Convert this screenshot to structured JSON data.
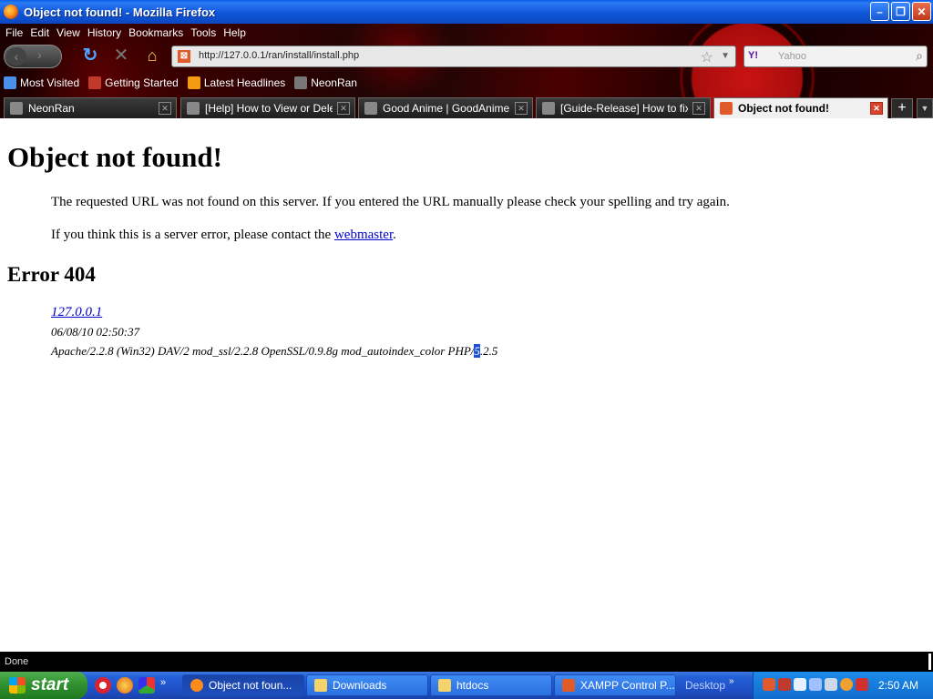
{
  "window": {
    "title": "Object not found! - Mozilla Firefox",
    "minimize_glyph": "–",
    "maximize_glyph": "❐",
    "close_glyph": "✕"
  },
  "menu": [
    "File",
    "Edit",
    "View",
    "History",
    "Bookmarks",
    "Tools",
    "Help"
  ],
  "nav": {
    "back_icon": "back-arrow-icon",
    "forward_icon": "forward-arrow-icon",
    "reload_icon": "reload-icon",
    "stop_icon": "stop-icon",
    "home_icon": "home-icon"
  },
  "urlbar": {
    "url": "http://127.0.0.1/ran/install/install.php",
    "site_icon": "xampp-icon"
  },
  "searchbar": {
    "engine": "Y!",
    "placeholder": "Yahoo"
  },
  "bookmarks": [
    {
      "label": "Most Visited",
      "icon": "most-visited-icon",
      "color": "#4a8fe8"
    },
    {
      "label": "Getting Started",
      "icon": "firefox-icon",
      "color": "#c0392b"
    },
    {
      "label": "Latest Headlines",
      "icon": "rss-icon",
      "color": "#f39c12"
    },
    {
      "label": "NeonRan",
      "icon": "neonran-icon",
      "color": "#777777"
    }
  ],
  "tabs": [
    {
      "label": "NeonRan",
      "active": false
    },
    {
      "label": "[Help] How to View or Delet...",
      "active": false
    },
    {
      "label": "Good Anime | GoodAnime.Net",
      "active": false
    },
    {
      "label": "[Guide-Release] How to fix ...",
      "active": false
    },
    {
      "label": "Object not found!",
      "active": true
    }
  ],
  "page": {
    "heading": "Object not found!",
    "p1": "The requested URL was not found on this server. If you entered the URL manually please check your spelling and try again.",
    "p2_prefix": "If you think this is a server error, please contact the ",
    "p2_link": "webmaster",
    "p2_suffix": ".",
    "error_heading": "Error 404",
    "address": "127.0.0.1",
    "datetime": "06/08/10 02:50:37",
    "server_pre": "Apache/2.2.8 (Win32) DAV/2 mod_ssl/2.2.8 OpenSSL/0.9.8g mod_autoindex_color PHP/",
    "server_sel": "5",
    "server_post": ".2.5"
  },
  "status": {
    "text": "Done"
  },
  "taskbar": {
    "start_label": "start",
    "quick_chevron": "»",
    "tasks": [
      {
        "label": "Object not foun...",
        "active": true,
        "icon": "firefox-icon",
        "color": "#ff8c1a"
      },
      {
        "label": "Downloads",
        "active": false,
        "icon": "folder-icon",
        "color": "#f5d36b"
      },
      {
        "label": "htdocs",
        "active": false,
        "icon": "folder-icon",
        "color": "#f5d36b"
      },
      {
        "label": "XAMPP Control P...",
        "active": false,
        "icon": "xampp-icon",
        "color": "#e05a2a"
      }
    ],
    "desktop_label": "Desktop",
    "desktop_chevron": "»",
    "clock": "2:50 AM"
  },
  "colors": {
    "link": "#0000cc",
    "selection": "#1a4fd8",
    "taskbar": "#2560d8",
    "start": "#2f8f2f"
  }
}
